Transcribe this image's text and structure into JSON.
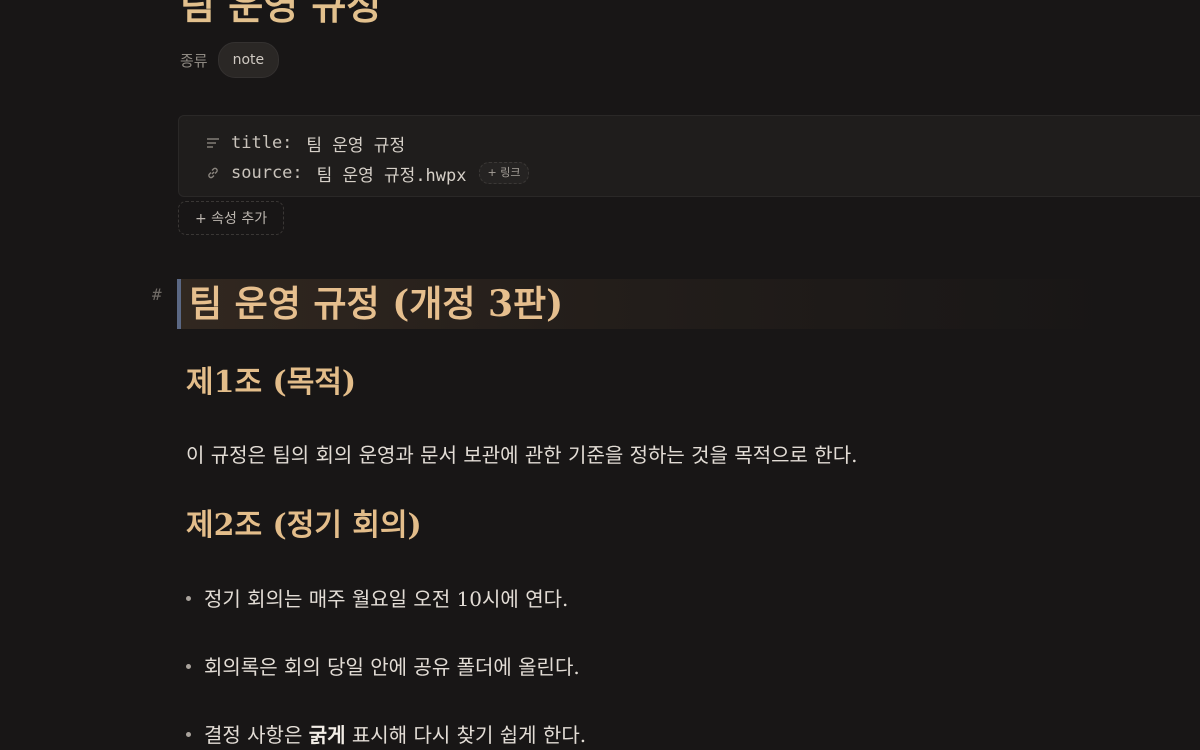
{
  "note": {
    "title": "팀 운영 규정",
    "type_label": "종류",
    "type_value": "note"
  },
  "properties": {
    "title": {
      "key": "title:",
      "value": "팀 운영 규정",
      "icon": "text-lines-icon"
    },
    "source": {
      "key": "source:",
      "value": "팀 운영 규정.hwpx",
      "icon": "link-icon",
      "link_chip": "+ 링크"
    },
    "add_label": "+ 속성 추가"
  },
  "content": {
    "heading_marker": "#",
    "h1": "팀 운영 규정 (개정 3판)",
    "article1": {
      "heading": "제1조 (목적)",
      "body": "이 규정은 팀의 회의 운영과 문서 보관에 관한 기준을 정하는 것을 목적으로 한다."
    },
    "article2": {
      "heading": "제2조 (정기 회의)",
      "bullets": [
        "정기 회의는 매주 월요일 오전 10시에 연다.",
        "회의록은 회의 당일 안에 공유 폴더에 올린다."
      ],
      "bullet3": {
        "before": "결정 사항은 ",
        "bold": "굵게",
        "after": " 표시해 다시 찾기 쉽게 한다."
      }
    }
  },
  "colors": {
    "background": "#181616",
    "heading_accent": "#e6bf8e",
    "h1_border": "#5b6884",
    "text": "#e2dcd5"
  }
}
